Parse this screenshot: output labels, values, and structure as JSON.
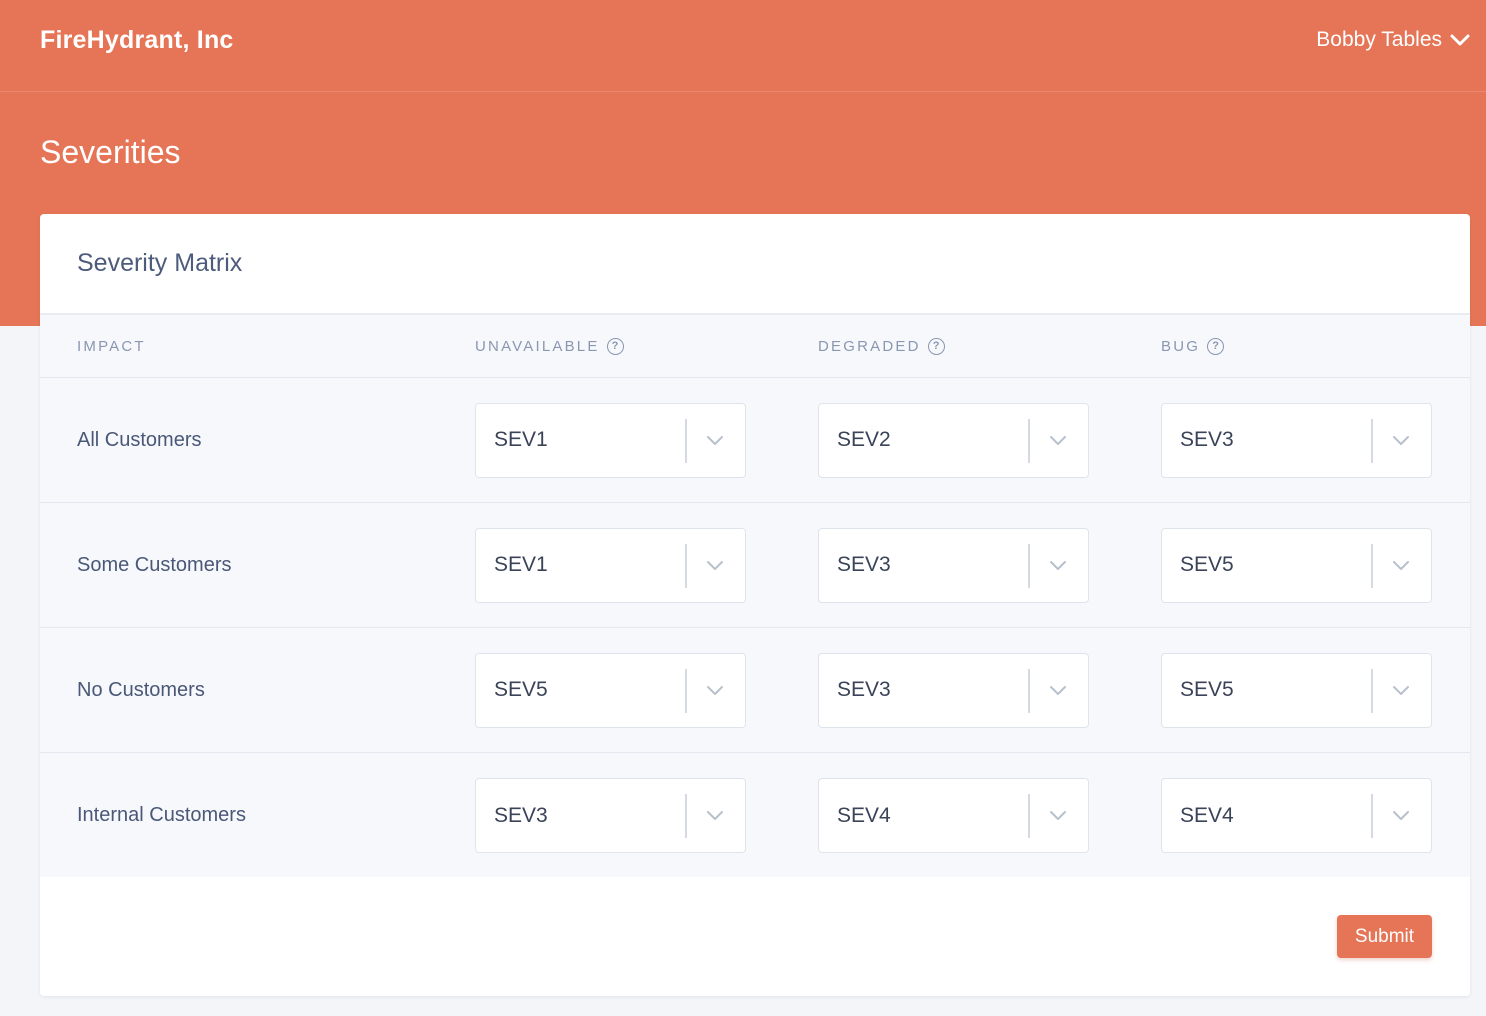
{
  "header": {
    "org_name": "FireHydrant, Inc",
    "user_name": "Bobby Tables",
    "page_title": "Severities"
  },
  "colors": {
    "brand": "#e57556",
    "background": "#f3f5f9",
    "card": "#ffffff"
  },
  "card": {
    "title": "Severity Matrix",
    "columns": [
      {
        "label": "IMPACT",
        "help": false
      },
      {
        "label": "UNAVAILABLE",
        "help": true
      },
      {
        "label": "DEGRADED",
        "help": true
      },
      {
        "label": "BUG",
        "help": true
      }
    ],
    "rows": [
      {
        "impact": "All Customers",
        "values": [
          "SEV1",
          "SEV2",
          "SEV3"
        ]
      },
      {
        "impact": "Some Customers",
        "values": [
          "SEV1",
          "SEV3",
          "SEV5"
        ]
      },
      {
        "impact": "No Customers",
        "values": [
          "SEV5",
          "SEV3",
          "SEV5"
        ]
      },
      {
        "impact": "Internal Customers",
        "values": [
          "SEV3",
          "SEV4",
          "SEV4"
        ]
      }
    ],
    "submit_label": "Submit"
  },
  "icons": {
    "user_menu": "chevron-down-icon",
    "column_help": "question-circle-icon",
    "select": "chevron-down-icon"
  }
}
